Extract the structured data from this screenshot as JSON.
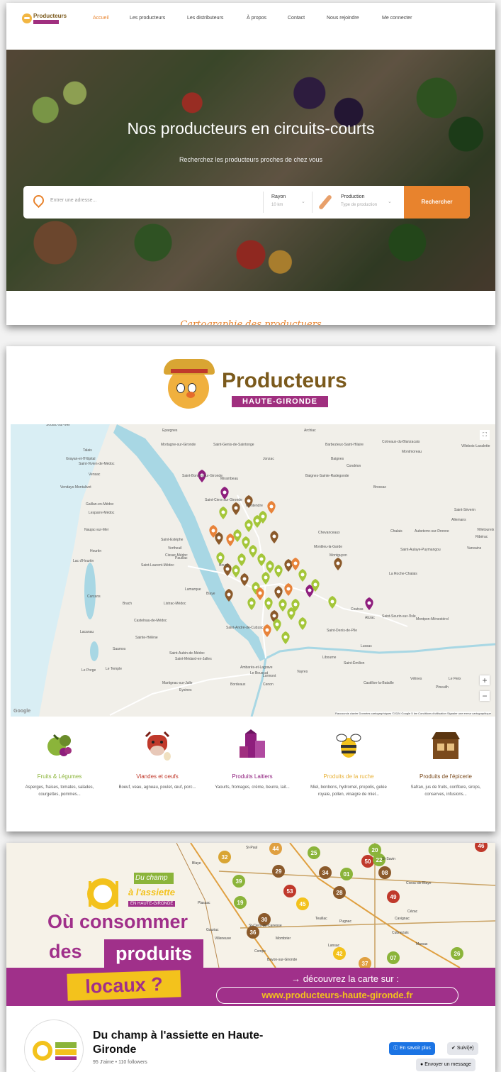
{
  "panel1": {
    "logo_text": "Producteurs",
    "nav": [
      "Accueil",
      "Les producteurs",
      "Les distributeurs",
      "À propos",
      "Contact",
      "Nous rejoindre",
      "Me connecter"
    ],
    "hero_title": "Nos producteurs en circuits-courts",
    "hero_subtitle": "Recherchez les producteurs proches de chez vous",
    "search": {
      "address_placeholder": "Entrer une adresse...",
      "radius_label": "Rayon",
      "radius_value": "10 km",
      "production_label": "Production",
      "production_value": "Type de production",
      "button": "Rechercher"
    },
    "section_title": "Cartographie des productuers"
  },
  "panel2": {
    "logo_title": "Producteurs",
    "logo_badge": "HAUTE-GIRONDE",
    "map": {
      "places": [
        "Soulac-sur-Mer",
        "Talais",
        "Grayan-et-l'Hôpital",
        "Saint-Vivien-de-Médoc",
        "Vensac",
        "Vendays-Montalivet",
        "Gaillan-en-Médoc",
        "Lesparre-Médoc",
        "Naujac-sur-Mer",
        "Hourtin",
        "Lac d'Hourtin",
        "Carcans",
        "Lacanau",
        "Saumos",
        "Le Porge",
        "Le Temple",
        "Brach",
        "Castelnau-de-Médoc",
        "Sainte-Hélène",
        "Saint-Laurent-Médoc",
        "Listrac-Médoc",
        "Pauillac",
        "Saint-Estèphe",
        "Vertheuil",
        "Cissac-Médoc",
        "Lamarque",
        "Saint-Aubin-de-Médoc",
        "Saint-Médard-en-Jalles",
        "Martignac-sur-Jalle",
        "Epargnes",
        "Mortagne-sur-Gironde",
        "Saint-Genis-de-Saintonge",
        "Jonzac",
        "Archiac",
        "Barbezieux-Saint-Hilaire",
        "Baignes",
        "Condéon",
        "Baignes-Sainte-Radegonde",
        "Cotreaux-du-Blanzacais",
        "Montmoreau",
        "Villebois-Lavalette",
        "Brossac",
        "Saint-Séverin",
        "Allemans",
        "Villetoureix",
        "Ribérac",
        "Vanxains",
        "Chalais",
        "Aubeterre-sur-Dronne",
        "Montendre",
        "Chevanceaux",
        "Montlieu-la-Garde",
        "Montguyon",
        "Saint-Aulaye-Puymangou",
        "La Roche-Chalais",
        "Coutras",
        "Abzac",
        "Saint-Seurin-sur-l'Isle",
        "Montpon-Ménestérol",
        "Saint-Denis-de-Pile",
        "Lussac",
        "Libourne",
        "Saint-Émilion",
        "Vayres",
        "Castillon-la-Bataille",
        "Vélines",
        "Le Fleix",
        "Pineuilh",
        "Saint-Bonnet-sur-Gironde",
        "Mirambeau",
        "Saint-Ciers-sur-Gironde",
        "Blaye",
        "Bourg",
        "Saint-André-de-Cubzac",
        "Ambarès-et-Lagrave",
        "Lormont",
        "Le Bouscat",
        "Cenon",
        "Bordeaux",
        "Eysines"
      ],
      "footer": "Raccourcis clavier   Données cartographiques ©2024 Google   5 km   Conditions d'utilisation   Signaler une erreur cartographique",
      "google": "Google",
      "zoom_in": "+",
      "zoom_out": "−",
      "fullscreen": "⛶",
      "pin_colors": {
        "green": "#a4c639",
        "brown": "#8b5a2b",
        "orange": "#e8833a",
        "purple": "#8e1e7d"
      }
    },
    "categories": [
      {
        "name": "Fruits & Légumes",
        "desc": "Asperges, fraises, tomates, salades, courgettes, pommes...",
        "color": "#8bb43a",
        "icon": "vegetables-icon"
      },
      {
        "name": "Viandes et oeufs",
        "desc": "Boeuf, veau, agneau, poulet, œuf, porc...",
        "color": "#c0392b",
        "icon": "cow-icon"
      },
      {
        "name": "Produits Laitiers",
        "desc": "Yaourts, fromages, crème, beurre, lait...",
        "color": "#8e1e7d",
        "icon": "milk-icon"
      },
      {
        "name": "Produits de la ruche",
        "desc": "Miel, bonbons, hydromel, propolis, gelée royale, pollen, vinaigre de miel...",
        "color": "#e8b23a",
        "icon": "bee-icon"
      },
      {
        "name": "Produits de l'épicerie",
        "desc": "Safran, jus de fruits, confiture, sirops, conserves, infusions...",
        "color": "#7a4a1c",
        "icon": "shop-icon"
      }
    ]
  },
  "panel3": {
    "cover_logo_line1": "Du champ",
    "cover_logo_line2": "à l'assiette",
    "cover_logo_line3": "EN HAUTE-GIRONDE",
    "q_line1": "Où consommer",
    "q_line2a": "des",
    "q_line2b": "produits",
    "q_line3": "locaux ?",
    "cta_line1": "→ découvrez la carte sur :",
    "cta_url": "www.producteurs-haute-gironde.fr",
    "map_numbers": [
      "32",
      "44",
      "25",
      "20",
      "46",
      "29",
      "39",
      "34",
      "01",
      "50",
      "08",
      "22",
      "19",
      "28",
      "53",
      "45",
      "49",
      "30",
      "36",
      "42",
      "07",
      "37",
      "26"
    ],
    "map_places": [
      "Blaye",
      "St-Paul",
      "St-Savin",
      "Plassac",
      "St-Ciers-de-Canesse",
      "Teuillac",
      "Cavignac",
      "Cubnezais",
      "Marsas",
      "Pugnac",
      "Lansac",
      "Comps",
      "Bayon-sur-Gironde",
      "Mombrier",
      "Cézac",
      "Civrac-de-Blaye",
      "Gauriac",
      "Villeneuve"
    ],
    "page_name": "Du champ à l'assiette en Haute-Gironde",
    "stats": "95 J'aime • 110 followers",
    "btn_learn": "En savoir plus",
    "btn_follow": "Suivi(e)",
    "btn_message": "Envoyer un message"
  }
}
